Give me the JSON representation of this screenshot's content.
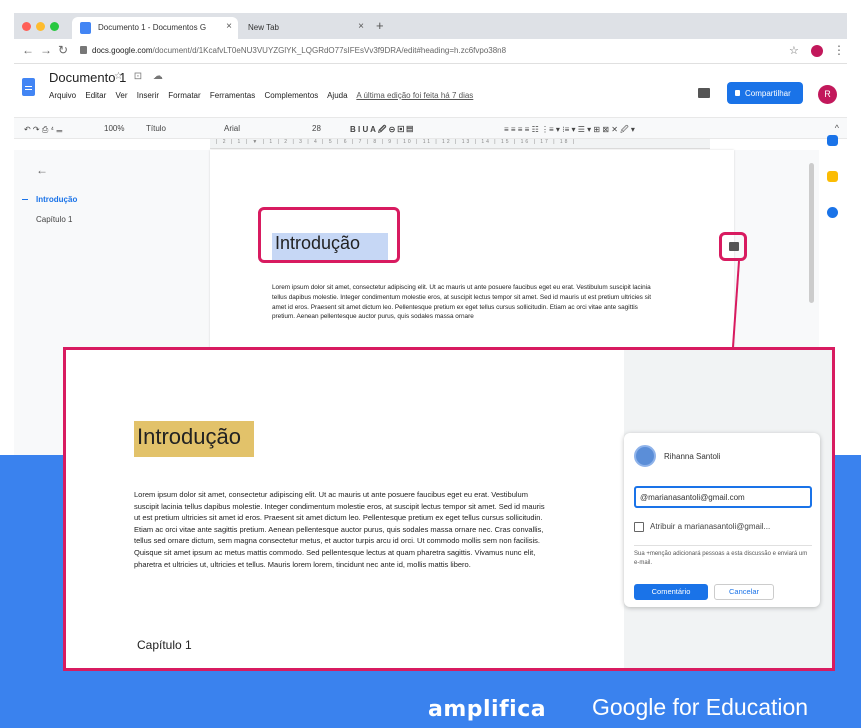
{
  "browser": {
    "tabs": [
      {
        "label": "Documento 1 - Documentos G"
      },
      {
        "label": "New Tab"
      }
    ],
    "new_tab": "+",
    "tab_close": "×",
    "url_domain": "docs.google.com",
    "url_path": "/document/d/1KcafvLT0eNU3VUYZGlYK_LQGRdO77sIFEsVv3f9DRA/edit#heading=h.zc6fvpo38n8"
  },
  "doc": {
    "title": "Documento 1",
    "title_icons": "☆ ⊡ ☁",
    "menu": [
      "Arquivo",
      "Editar",
      "Ver",
      "Inserir",
      "Formatar",
      "Ferramentas",
      "Complementos",
      "Ajuda"
    ],
    "last_edit": "A última edição foi feita há 7 dias",
    "share_label": "Compartilhar",
    "user_initial": "R"
  },
  "toolbar": {
    "undo_group": "↶ ↷ ⎙ ⁴ 𝍡",
    "zoom": "100%",
    "style": "Título",
    "font": "Arial",
    "size": "28",
    "format_group": "B  I  U  A  🖉   ⊝  ▣  ▤",
    "align_group": "≡  ≡  ≡  ≡     ☷   ⋮≡ ▾  ⁝≡ ▾  ☰ ▾   ⊞   ⊠     ✕ 🖉 ▾",
    "collapse": "^"
  },
  "ruler_text": "| 2 | 1 | ▼ | 1 | 2 | 3 | 4 | 5 | 6 | 7 | 8 | 9 | 10 | 11 | 12 | 13 | 14 | 15 | 16 | 17 | 18 |",
  "outline": {
    "back": "←",
    "items": [
      "Introdução",
      "Capítulo 1"
    ]
  },
  "page": {
    "heading": "Introdução",
    "body": "Lorem ipsum dolor sit amet, consectetur adipiscing elit. Ut ac mauris ut ante posuere faucibus eget eu erat. Vestibulum suscipit lacinia tellus dapibus molestie. Integer condimentum molestie eros, at suscipit lectus tempor sit amet. Sed id mauris ut est pretium ultricies sit amet id eros. Praesent sit amet dictum leo. Pellentesque pretium ex eget tellus cursus sollicitudin. Etiam ac orci vitae ante sagittis pretium. Aenean pellentesque auctor purus, quis sodales massa ornare"
  },
  "zoom": {
    "heading": "Introdução",
    "body": "Lorem ipsum dolor sit amet, consectetur adipiscing elit. Ut ac mauris ut ante posuere faucibus eget eu erat. Vestibulum suscipit lacinia tellus dapibus molestie. Integer condimentum molestie eros, at suscipit lectus tempor sit amet. Sed id mauris ut est pretium ultricies sit amet id eros. Praesent sit amet dictum leo. Pellentesque pretium ex eget tellus cursus sollicitudin. Etiam ac orci vitae ante sagittis pretium. Aenean pellentesque auctor purus, quis sodales massa ornare nec. Cras convallis, tellus sed ornare dictum, sem magna consectetur metus, et auctor turpis arcu id orci. Ut commodo mollis sem non facilisis. Quisque sit amet ipsum ac metus mattis commodo. Sed pellentesque lectus at quam pharetra sagittis. Vivamus nunc elit, pharetra et ultricies ut, ultricies et tellus. Mauris lorem lorem, tincidunt nec ante id, mollis mattis libero.",
    "chapter": "Capítulo 1"
  },
  "comment": {
    "author": "Rihanna Santoli",
    "input_value": "@marianasantoli@gmail.com",
    "assign_label": "Atribuir a marianasantoli@gmail...",
    "note": "Sua +menção adicionará pessoas a esta discussão e enviará um e-mail.",
    "submit": "Comentário",
    "cancel": "Cancelar"
  },
  "footer": {
    "brand": "amplifica",
    "partner": "Google for Education"
  },
  "colors": {
    "accent": "#d81b60",
    "blue": "#3a82ee",
    "google_blue": "#1a73e8"
  }
}
